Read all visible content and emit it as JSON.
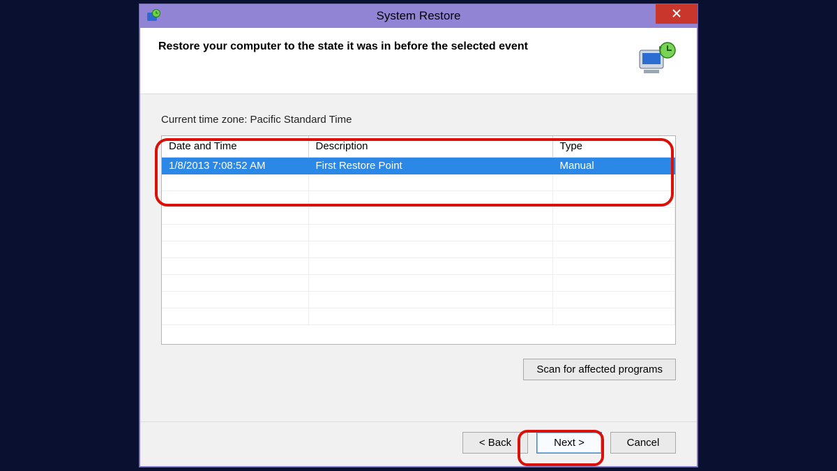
{
  "window": {
    "title": "System Restore"
  },
  "header": {
    "heading": "Restore your computer to the state it was in before the selected event"
  },
  "body": {
    "timezone_label": "Current time zone: Pacific Standard Time",
    "columns": {
      "datetime": "Date and Time",
      "description": "Description",
      "type": "Type"
    },
    "rows": [
      {
        "datetime": "1/8/2013 7:08:52 AM",
        "description": "First Restore Point",
        "type": "Manual",
        "selected": true
      }
    ],
    "scan_button": "Scan for affected programs"
  },
  "footer": {
    "back": "< Back",
    "next": "Next >",
    "cancel": "Cancel"
  }
}
